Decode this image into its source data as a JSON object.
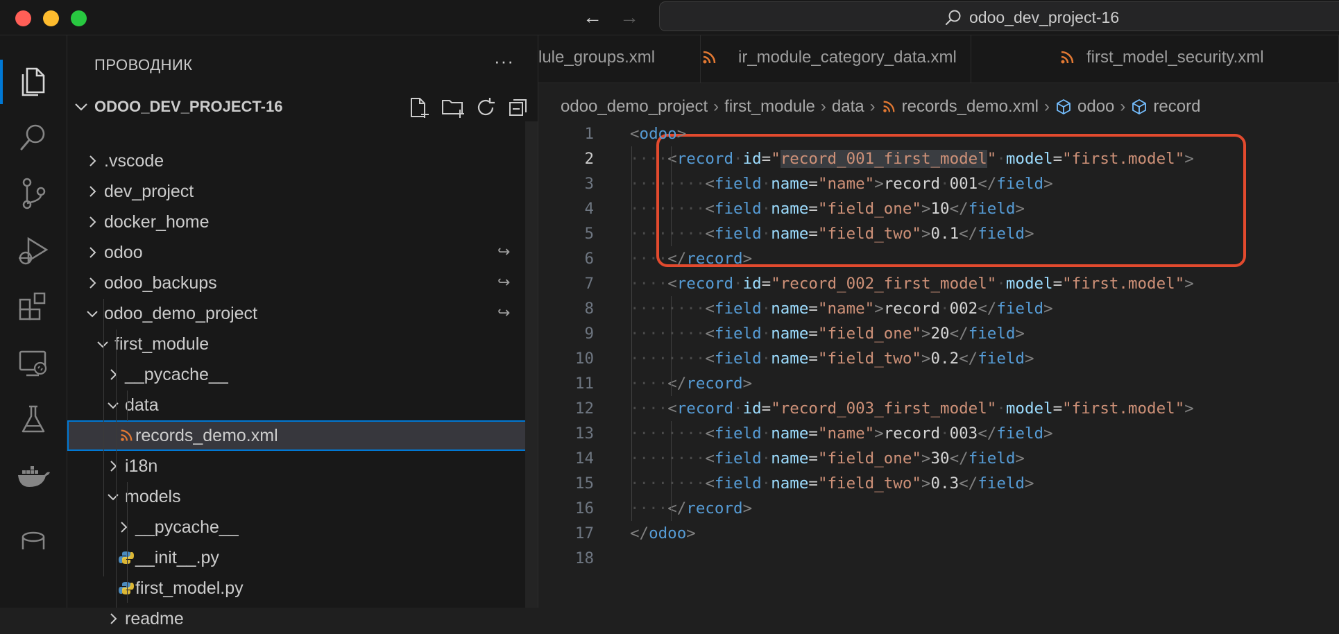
{
  "titlebar": {
    "search_text": "odoo_dev_project-16",
    "back_icon": "arrow-left-icon",
    "forward_icon": "arrow-right-icon"
  },
  "activity_bar": [
    "explorer-icon",
    "search-icon",
    "source-control-icon",
    "run-debug-icon",
    "extensions-icon",
    "remote-explorer-icon",
    "testing-icon",
    "docker-icon",
    "database-icon"
  ],
  "sidebar": {
    "title": "ПРОВОДНИК",
    "more": "···",
    "project_name": "ODOO_DEV_PROJECT-16",
    "tree": [
      {
        "label": ".vscode",
        "type": "folder",
        "expanded": false
      },
      {
        "label": "dev_project",
        "type": "folder",
        "expanded": false
      },
      {
        "label": "docker_home",
        "type": "folder",
        "expanded": false
      },
      {
        "label": "odoo",
        "type": "folder",
        "expanded": false,
        "symlink": true
      },
      {
        "label": "odoo_backups",
        "type": "folder",
        "expanded": false,
        "symlink": true
      },
      {
        "label": "odoo_demo_project",
        "type": "folder",
        "expanded": true,
        "symlink": true
      },
      {
        "label": "first_module",
        "type": "folder",
        "expanded": true
      },
      {
        "label": "__pycache__",
        "type": "folder",
        "expanded": false
      },
      {
        "label": "data",
        "type": "folder",
        "expanded": true
      },
      {
        "label": "records_demo.xml",
        "type": "xml",
        "selected": true
      },
      {
        "label": "i18n",
        "type": "folder",
        "expanded": false
      },
      {
        "label": "models",
        "type": "folder",
        "expanded": true
      },
      {
        "label": "__pycache__",
        "type": "folder",
        "expanded": false
      },
      {
        "label": "__init__.py",
        "type": "python"
      },
      {
        "label": "first_model.py",
        "type": "python"
      },
      {
        "label": "readme",
        "type": "folder",
        "expanded": false
      }
    ]
  },
  "tabs": [
    {
      "label": "lule_groups.xml"
    },
    {
      "label": "ir_module_category_data.xml"
    },
    {
      "label": "first_model_security.xml"
    }
  ],
  "breadcrumb": [
    "odoo_demo_project",
    "first_module",
    "data",
    "records_demo.xml",
    "odoo",
    "record"
  ],
  "editor": {
    "current_line": 2,
    "lines": [
      "<odoo>",
      "    <record id=\"record_001_first_model\" model=\"first.model\">",
      "        <field name=\"name\">record 001</field>",
      "        <field name=\"field_one\">10</field>",
      "        <field name=\"field_two\">0.1</field>",
      "    </record>",
      "    <record id=\"record_002_first_model\" model=\"first.model\">",
      "        <field name=\"name\">record 002</field>",
      "        <field name=\"field_one\">20</field>",
      "        <field name=\"field_two\">0.2</field>",
      "    </record>",
      "    <record id=\"record_003_first_model\" model=\"first.model\">",
      "        <field name=\"name\">record 003</field>",
      "        <field name=\"field_one\">30</field>",
      "        <field name=\"field_two\">0.3</field>",
      "    </record>",
      "</odoo>",
      ""
    ]
  },
  "colors": {
    "accent": "#0078d4",
    "highlight_box": "#e24a2e",
    "xml_icon": "#e37933",
    "python_icon": "#4b8bbe"
  }
}
